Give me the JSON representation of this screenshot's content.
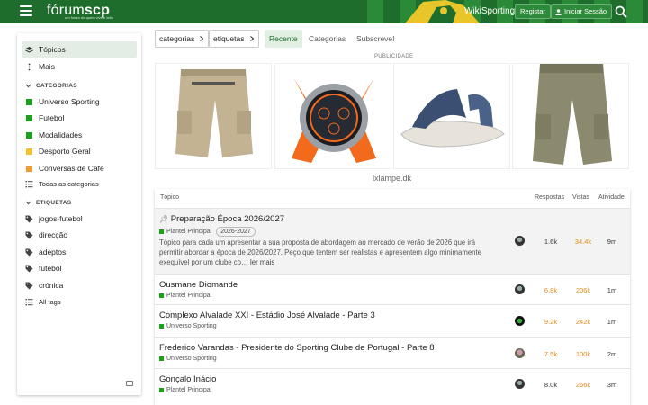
{
  "header": {
    "logo_main": "fórum",
    "logo_scp": "scp",
    "logo_sub": "um forum de quem vive o leão",
    "wiki": "WikiSporting",
    "register": "Registar",
    "login": "Iniciar Sessão",
    "brand_color": "#1f6d2c"
  },
  "sidebar": {
    "topics": "Tópicos",
    "more": "Mais",
    "categories_head": "CATEGORIAS",
    "categories": [
      {
        "label": "Universo Sporting",
        "color": "#1aa31a"
      },
      {
        "label": "Futebol",
        "color": "#1aa31a"
      },
      {
        "label": "Modalidades",
        "color": "#1aa31a"
      },
      {
        "label": "Desporto Geral",
        "color": "#f2c230"
      },
      {
        "label": "Conversas de Café",
        "color": "#f29b30"
      }
    ],
    "all_categories": "Todas as categorias",
    "tags_head": "ETIQUETAS",
    "tags": [
      "jogos-futebol",
      "direcção",
      "adeptos",
      "futebol",
      "crónica"
    ],
    "all_tags": "All tags"
  },
  "nav": {
    "categorias": "categorias",
    "etiquetas": "etiquetas",
    "recente": "Recente",
    "categorias_link": "Categorias",
    "subscreve": "Subscreve!"
  },
  "ad": {
    "label": "PUBLICIDADE",
    "site": "lxlampe.dk"
  },
  "table": {
    "col_topic": "Tópico",
    "col_replies": "Respostas",
    "col_views": "Vistas",
    "col_activity": "Atividade",
    "rows": [
      {
        "title": "Preparação Época 2026/2027",
        "category": "Plantel Principal",
        "tag": "2026-2027",
        "pinned": true,
        "excerpt": "Tópico para cada um apresentar a sua proposta de abordagem ao mercado de verão de 2026 que irá permitir abordar a época de 2026/2027. Peço que tentem ser realistas e apresentem algo minimamente exequível por um clube co…",
        "more": "ler mais",
        "replies": "1.6k",
        "views": "34.4k",
        "activity": "9m"
      },
      {
        "title": "Ousmane Diomande",
        "category": "Plantel Principal",
        "replies": "6.8k",
        "views": "206k",
        "activity": "1m"
      },
      {
        "title": "Complexo Alvalade XXI - Estádio José Alvalade - Parte 3",
        "category": "Universo Sporting",
        "replies": "9.2k",
        "views": "242k",
        "activity": "1m"
      },
      {
        "title": "Frederico Varandas - Presidente do Sporting Clube de Portugal - Parte 8",
        "category": "Universo Sporting",
        "replies": "7.5k",
        "views": "100k",
        "activity": "2m"
      },
      {
        "title": "Gonçalo Inácio",
        "category": "Plantel Principal",
        "replies": "8.0k",
        "views": "266k",
        "activity": "3m"
      }
    ]
  }
}
